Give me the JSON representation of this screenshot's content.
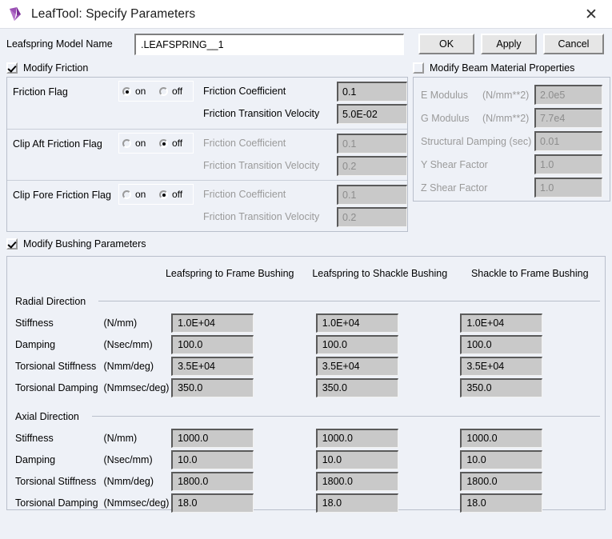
{
  "window": {
    "title": "LeafTool: Specify Parameters",
    "icon": "leaftool-logo-icon",
    "close_label": "✕"
  },
  "model_name_row": {
    "label": "Leafspring Model Name",
    "value": ".LEAFSPRING__1",
    "placeholder": "",
    "buttons": {
      "ok": "OK",
      "apply": "Apply",
      "cancel": "Cancel"
    }
  },
  "friction": {
    "checkbox_label": "Modify Friction",
    "checked": true,
    "rows": [
      {
        "name": "Friction Flag",
        "on_label": "on",
        "off_label": "off",
        "selected": "on",
        "enabled": true,
        "coefficient_label": "Friction Coefficient",
        "coefficient_value": "0.1",
        "velocity_label": "Friction Transition Velocity",
        "velocity_value": "5.0E-02"
      },
      {
        "name": "Clip Aft Friction Flag",
        "on_label": "on",
        "off_label": "off",
        "selected": "off",
        "enabled": false,
        "coefficient_label": "Friction Coefficient",
        "coefficient_value": "0.1",
        "velocity_label": "Friction Transition Velocity",
        "velocity_value": "0.2"
      },
      {
        "name": "Clip Fore Friction Flag",
        "on_label": "on",
        "off_label": "off",
        "selected": "off",
        "enabled": false,
        "coefficient_label": "Friction Coefficient",
        "coefficient_value": "0.1",
        "velocity_label": "Friction Transition Velocity",
        "velocity_value": "0.2"
      }
    ]
  },
  "beam_material": {
    "checkbox_label": "Modify Beam Material Properties",
    "checked": false,
    "rows": [
      {
        "label": "E Modulus",
        "unit": "(N/mm**2)",
        "value": "2.0e5"
      },
      {
        "label": "G Modulus",
        "unit": "(N/mm**2)",
        "value": "7.7e4"
      },
      {
        "label": "Structural Damping (sec)",
        "unit": "",
        "value": "0.01"
      },
      {
        "label": "Y Shear Factor",
        "unit": "",
        "value": "1.0"
      },
      {
        "label": "Z Shear Factor",
        "unit": "",
        "value": "1.0"
      }
    ]
  },
  "bushing": {
    "checkbox_label": "Modify Bushing Parameters",
    "checked": true,
    "columns": [
      "Leafspring to Frame Bushing",
      "Leafspring to Shackle Bushing",
      "Shackle to Frame Bushing"
    ],
    "sections": [
      {
        "title": "Radial Direction",
        "rows": [
          {
            "label": "Stiffness",
            "unit": "(N/mm)",
            "values": [
              "1.0E+04",
              "1.0E+04",
              "1.0E+04"
            ]
          },
          {
            "label": "Damping",
            "unit": "(Nsec/mm)",
            "values": [
              "100.0",
              "100.0",
              "100.0"
            ]
          },
          {
            "label": "Torsional Stiffness",
            "unit": "(Nmm/deg)",
            "values": [
              "3.5E+04",
              "3.5E+04",
              "3.5E+04"
            ]
          },
          {
            "label": "Torsional Damping",
            "unit": "(Nmmsec/deg)",
            "values": [
              "350.0",
              "350.0",
              "350.0"
            ]
          }
        ]
      },
      {
        "title": "Axial Direction",
        "rows": [
          {
            "label": "Stiffness",
            "unit": "(N/mm)",
            "values": [
              "1000.0",
              "1000.0",
              "1000.0"
            ]
          },
          {
            "label": "Damping",
            "unit": "(Nsec/mm)",
            "values": [
              "10.0",
              "10.0",
              "10.0"
            ]
          },
          {
            "label": "Torsional Stiffness",
            "unit": "(Nmm/deg)",
            "values": [
              "1800.0",
              "1800.0",
              "1800.0"
            ]
          },
          {
            "label": "Torsional Damping",
            "unit": "(Nmmsec/deg)",
            "values": [
              "18.0",
              "18.0",
              "18.0"
            ]
          }
        ]
      }
    ]
  },
  "colors": {
    "window_bg": "#eef1f7",
    "titlebar_bg": "#ffffff",
    "field_bg": "#c9c9c9",
    "input_bg": "#ffffff",
    "button_bg": "#e6e6e6",
    "disabled_text": "#9a9a9a",
    "icon_accent": "#8b3fa8"
  }
}
